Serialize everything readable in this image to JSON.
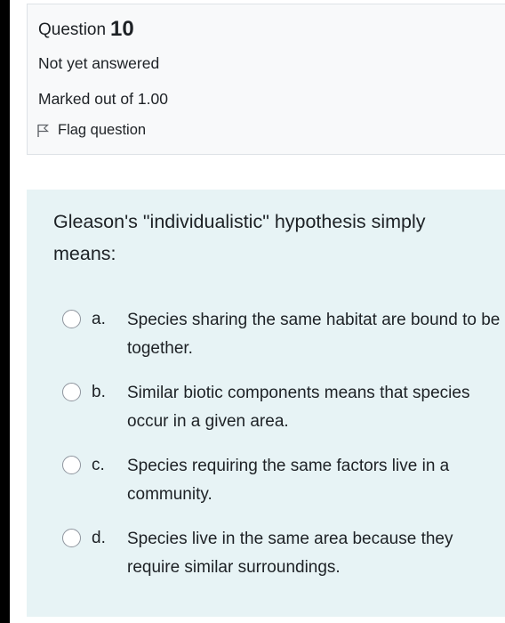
{
  "question_info": {
    "label": "Question",
    "number": "10",
    "state": "Not yet answered",
    "grade": "Marked out of 1.00",
    "flag_label": "Flag question"
  },
  "question": {
    "text": "Gleason's \"individualistic\" hypothesis simply means:",
    "options": [
      {
        "letter": "a.",
        "text": "Species sharing the same habitat are bound to be together."
      },
      {
        "letter": "b.",
        "text": "Similar biotic components means that species occur in a given area."
      },
      {
        "letter": "c.",
        "text": "Species requiring the same factors live in a community."
      },
      {
        "letter": "d.",
        "text": "Species live in the same area because they require similar surroundings."
      }
    ]
  },
  "colors": {
    "info_bg": "#f8f9fa",
    "formulation_bg": "#e7f3f5",
    "text": "#1d2125"
  }
}
